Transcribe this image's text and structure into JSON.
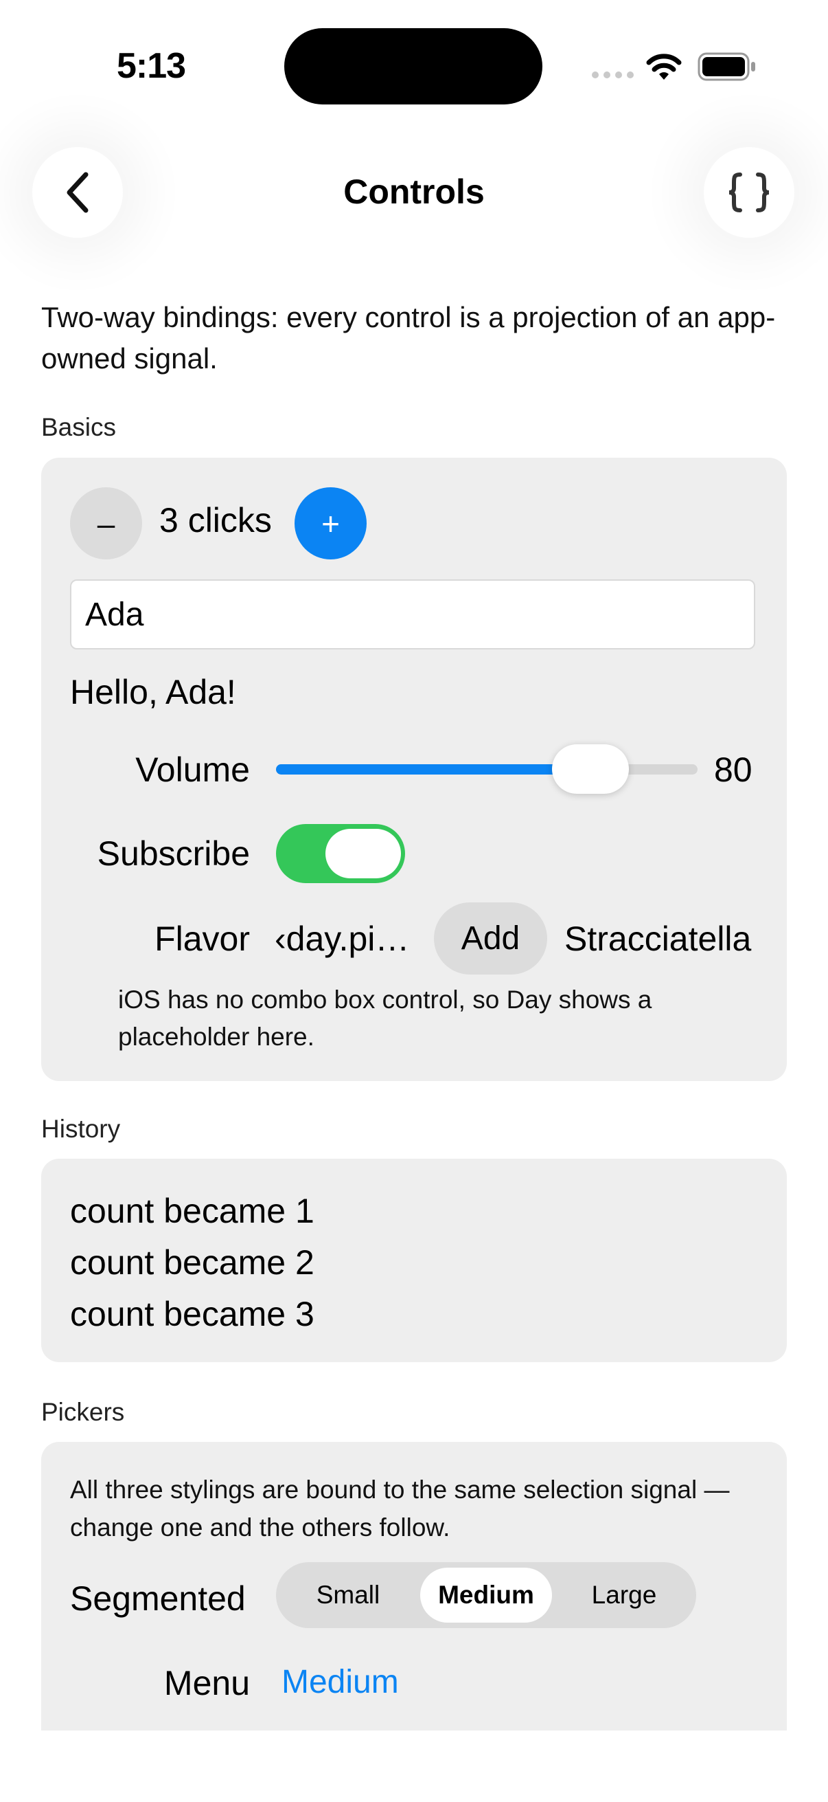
{
  "status_bar": {
    "time": "5:13"
  },
  "nav": {
    "title": "Controls"
  },
  "intro": "Two-way bindings: every control is a projection of an app-owned signal.",
  "basics": {
    "section_label": "Basics",
    "minus_label": "–",
    "plus_label": "+",
    "clicks_text": "3 clicks",
    "name_value": "Ada",
    "greeting": "Hello, Ada!",
    "volume_label": "Volume",
    "volume_value": "80",
    "volume_fraction": 0.8,
    "subscribe_label": "Subscribe",
    "subscribe_on": true,
    "flavor_label": "Flavor",
    "flavor_combo_text": "‹day.pi…",
    "add_label": "Add",
    "flavor_value": "Stracciatella",
    "combo_note": "iOS has no combo box control, so Day shows a placeholder here."
  },
  "history": {
    "section_label": "History",
    "items": [
      "count became 1",
      "count became 2",
      "count became 3"
    ]
  },
  "pickers": {
    "section_label": "Pickers",
    "description": "All three stylings are bound to the same selection signal — change one and the others follow.",
    "segmented_label": "Segmented",
    "segments": [
      "Small",
      "Medium",
      "Large"
    ],
    "selected": "Medium",
    "menu_label": "Menu",
    "menu_value": "Medium"
  },
  "colors": {
    "accent": "#0b84f3",
    "toggle_on": "#34c759",
    "card_bg": "#eeeeee"
  },
  "icons": {
    "back": "chevron-left-icon",
    "code": "curly-braces-icon",
    "wifi": "wifi-icon",
    "battery": "battery-icon"
  }
}
